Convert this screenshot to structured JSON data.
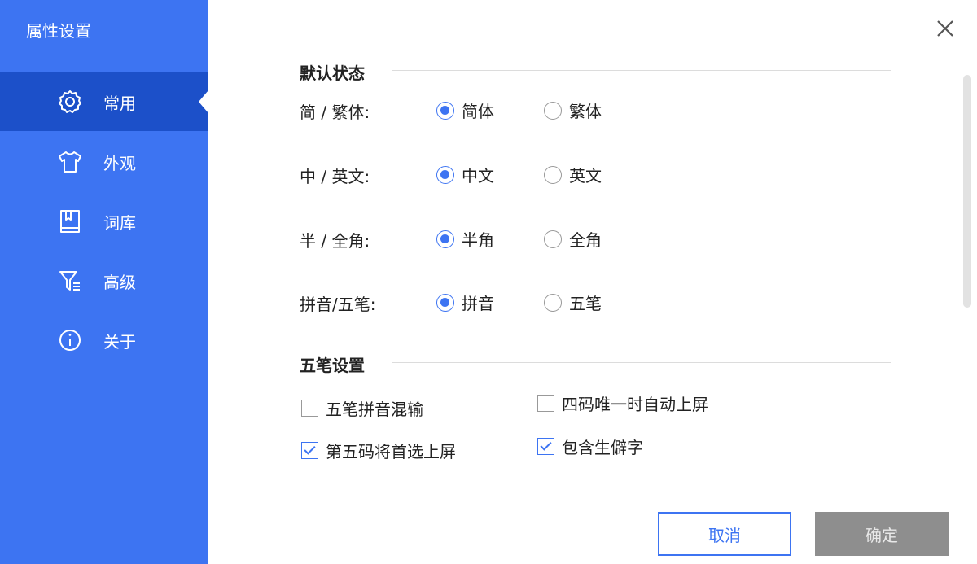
{
  "sidebar": {
    "title": "属性设置",
    "items": [
      {
        "label": "常用",
        "icon": "gear-icon",
        "active": true
      },
      {
        "label": "外观",
        "icon": "shirt-icon"
      },
      {
        "label": "词库",
        "icon": "book-icon"
      },
      {
        "label": "高级",
        "icon": "filter-icon"
      },
      {
        "label": "关于",
        "icon": "info-icon"
      }
    ]
  },
  "colors": {
    "accent": "#3d74f2",
    "sidebar_bg": "#3d74f2",
    "sidebar_active": "#1c50c9",
    "ok_disabled": "#8e8e8e"
  },
  "sections": {
    "default_state": {
      "title": "默认状态",
      "rows": [
        {
          "label": "简 / 繁体:",
          "options": [
            "简体",
            "繁体"
          ],
          "selected": 0
        },
        {
          "label": "中 / 英文:",
          "options": [
            "中文",
            "英文"
          ],
          "selected": 0
        },
        {
          "label": "半 / 全角:",
          "options": [
            "半角",
            "全角"
          ],
          "selected": 0
        },
        {
          "label": "拼音/五笔:",
          "options": [
            "拼音",
            "五笔"
          ],
          "selected": 0
        }
      ]
    },
    "wubi": {
      "title": "五笔设置",
      "options": [
        {
          "label": "五笔拼音混输",
          "checked": false
        },
        {
          "label": "四码唯一时自动上屏",
          "checked": false
        },
        {
          "label": "第五码将首选上屏",
          "checked": true
        },
        {
          "label": "包含生僻字",
          "checked": true
        }
      ]
    }
  },
  "footer": {
    "cancel_label": "取消",
    "ok_label": "确定"
  }
}
